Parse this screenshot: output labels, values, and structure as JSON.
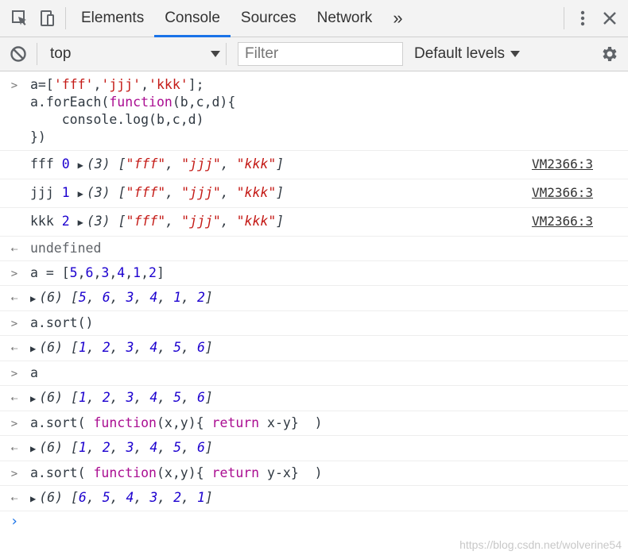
{
  "tabs": [
    "Elements",
    "Console",
    "Sources",
    "Network"
  ],
  "more_tabs": "»",
  "context": "top",
  "filter_placeholder": "Filter",
  "levels": "Default levels",
  "source_link": "VM2366:3",
  "undefined_text": "undefined",
  "watermark": "https://blog.csdn.net/wolverine54",
  "input_code": [
    "a=['fff','jjj','kkk'];",
    "a.forEach(function(b,c,d){",
    "    console.log(b,c,d)",
    "})"
  ],
  "logs": [
    {
      "value": "fff",
      "index": "0"
    },
    {
      "value": "jjj",
      "index": "1"
    },
    {
      "value": "kkk",
      "index": "2"
    }
  ],
  "array_summary": "(3) [\"fff\", \"jjj\", \"kkk\"]",
  "commands": [
    {
      "input": "a = [5,6,3,4,1,2]",
      "output": "(6) [5, 6, 3, 4, 1, 2]"
    },
    {
      "input": "a.sort()",
      "output": "(6) [1, 2, 3, 4, 5, 6]"
    },
    {
      "input": "a",
      "output": "(6) [1, 2, 3, 4, 5, 6]"
    },
    {
      "input": "a.sort( function(x,y){ return x-y}  )",
      "output": "(6) [1, 2, 3, 4, 5, 6]"
    },
    {
      "input": "a.sort( function(x,y){ return y-x}  )",
      "output": "(6) [6, 5, 4, 3, 2, 1]"
    }
  ]
}
